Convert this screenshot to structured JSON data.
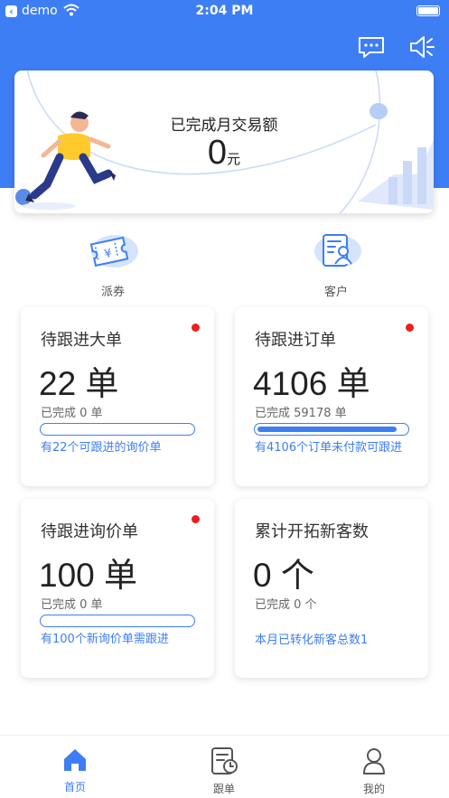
{
  "status_bar": {
    "carrier": "demo",
    "time": "2:04 PM"
  },
  "header": {
    "message_icon": "chat-icon",
    "speaker_icon": "speaker-icon"
  },
  "hero": {
    "title": "已完成月交易额",
    "amount": "0",
    "unit": "元"
  },
  "shortcuts": [
    {
      "label": "派券",
      "icon": "coupon-icon"
    },
    {
      "label": "客户",
      "icon": "customer-icon"
    }
  ],
  "cards": [
    {
      "title": "待跟进大单",
      "value": "22 单",
      "done": "已完成 0 单",
      "progress": 0,
      "link": "有22个可跟进的询价单",
      "dot": true
    },
    {
      "title": "待跟进订单",
      "value": "4106 单",
      "done": "已完成 59178 单",
      "progress": 0.94,
      "link": "有4106个订单未付款可跟进",
      "dot": true
    },
    {
      "title": "待跟进询价单",
      "value": "100 单",
      "done": "已完成 0 单",
      "progress": 0,
      "link": "有100个新询价单需跟进",
      "dot": true
    },
    {
      "title": "累计开拓新客数",
      "value": "0 个",
      "done": "已完成 0 个",
      "link": "本月已转化新客总数1",
      "dot": false
    }
  ],
  "tabbar": {
    "items": [
      {
        "label": "首页",
        "icon": "home-icon",
        "active": true
      },
      {
        "label": "跟单",
        "icon": "order-tracking-icon",
        "active": false
      },
      {
        "label": "我的",
        "icon": "profile-icon",
        "active": false
      }
    ]
  },
  "colors": {
    "accent": "#3d7ef5",
    "dot": "#e8211d",
    "inactive": "#555555"
  }
}
